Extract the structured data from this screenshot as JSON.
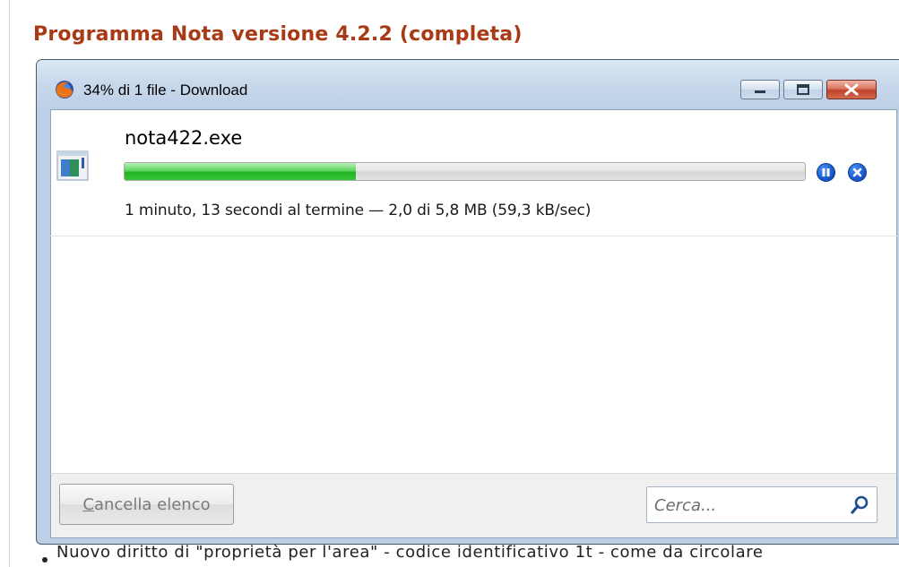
{
  "page": {
    "heading": "Programma Nota versione 4.2.2 (completa)",
    "bottom_text": "Nuovo diritto di \"proprietà per l'area\" - codice identificativo 1t - come da circolare"
  },
  "window": {
    "title": "34% di 1 file - Download",
    "icon": "firefox-icon",
    "controls": [
      "minimize",
      "maximize",
      "close"
    ]
  },
  "download": {
    "file_name": "nota422.exe",
    "progress": 0.34,
    "status": "1 minuto, 13 secondi al termine — 2,0 di 5,8 MB (59,3 kB/sec)",
    "actions": [
      "pause",
      "cancel"
    ]
  },
  "footer": {
    "clear_label_first": "C",
    "clear_label_rest": "ancella elenco",
    "search_placeholder": "Cerca..."
  },
  "colors": {
    "heading": "#a83a16",
    "progress": "#20b520",
    "action_button": "#1c5fd2",
    "close_button": "#c0432b"
  }
}
